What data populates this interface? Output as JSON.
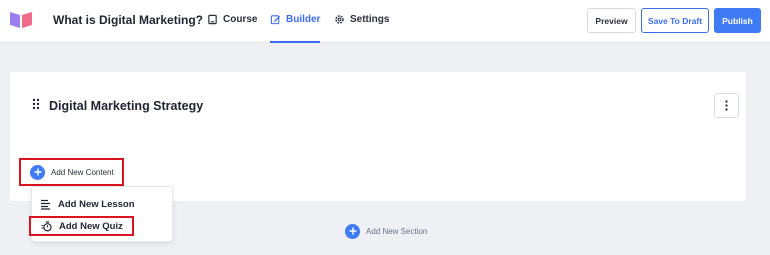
{
  "header": {
    "course_title": "What is Digital Marketing?",
    "tabs": [
      {
        "label": "Course",
        "icon": "book-icon"
      },
      {
        "label": "Builder",
        "icon": "edit-icon",
        "active": true
      },
      {
        "label": "Settings",
        "icon": "gear-icon"
      }
    ],
    "preview_label": "Preview",
    "save_draft_label": "Save To Draft",
    "publish_label": "Publish"
  },
  "section": {
    "title": "Digital Marketing Strategy",
    "add_content_label": "Add New Content"
  },
  "dropdown": {
    "items": [
      {
        "label": "Add New Lesson",
        "icon": "lesson-icon"
      },
      {
        "label": "Add New Quiz",
        "icon": "quiz-timer-icon"
      }
    ]
  },
  "add_section_label": "Add New Section",
  "colors": {
    "accent": "#3f7bf5",
    "highlight": "#d9141e",
    "background": "#eef0f3"
  }
}
